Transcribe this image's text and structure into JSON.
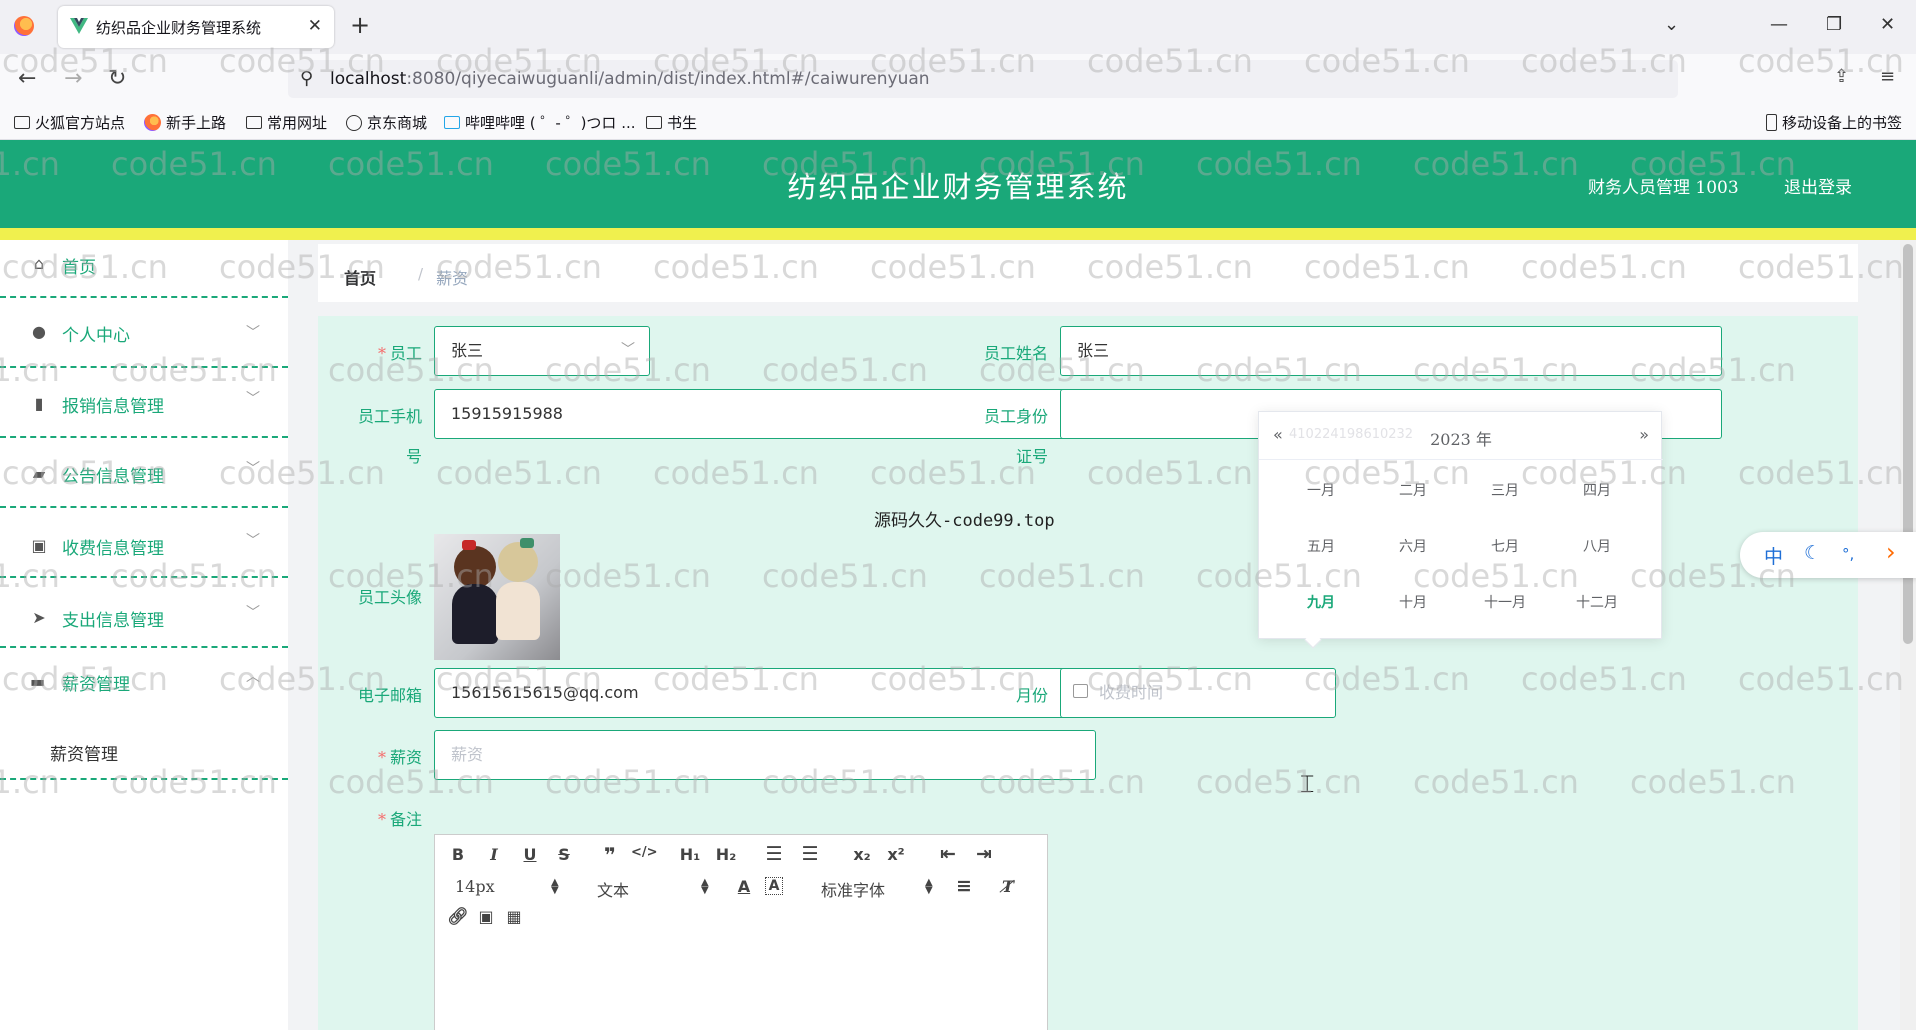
{
  "browser": {
    "tab_title": "纺织品企业财务管理系统",
    "tab_close": "✕",
    "new_tab": "+",
    "url_host": "localhost",
    "url_rest": ":8080/qiyecaiwuguanli/admin/dist/index.html#/caiwurenyuan",
    "bookmarks": [
      "火狐官方站点",
      "新手上路",
      "常用网址",
      "京东商城",
      "哔哩哔哩 ( ゜- ゜)つロ ...",
      "书生"
    ],
    "mobile_bookmarks": "移动设备上的书签"
  },
  "header": {
    "title": "纺织品企业财务管理系统",
    "user": "财务人员管理 1003",
    "logout": "退出登录",
    "accent": "#1aa879"
  },
  "sidebar": {
    "items": [
      {
        "label": "首页",
        "icon": "home-icon"
      },
      {
        "label": "个人中心",
        "icon": "user-icon"
      },
      {
        "label": "报销信息管理",
        "icon": "chart-icon"
      },
      {
        "label": "公告信息管理",
        "icon": "wallet-icon"
      },
      {
        "label": "收费信息管理",
        "icon": "fee-icon"
      },
      {
        "label": "支出信息管理",
        "icon": "send-icon"
      },
      {
        "label": "薪资管理",
        "icon": "ticket-icon"
      }
    ],
    "sub_item": "薪资管理"
  },
  "breadcrumb": {
    "home": "首页",
    "sep": "/",
    "current": "薪资"
  },
  "form": {
    "employee_label": "员工",
    "employee_value": "张三",
    "name_label": "员工姓名",
    "name_value": "张三",
    "phone_label_1": "员工手机",
    "phone_label_2": "号",
    "phone_value": "15915915988",
    "id_label_1": "员工身份",
    "id_label_2": "证号",
    "avatar_label": "员工头像",
    "email_label": "电子邮箱",
    "email_value": "15615615615@qq.com",
    "month_label": "月份",
    "month_placeholder": "收费时间",
    "salary_label": "薪资",
    "salary_placeholder": "薪资",
    "remark_label": "备注"
  },
  "month_picker": {
    "prev": "«",
    "next": "»",
    "year": "2023 年",
    "ghost_text": "410224198610232",
    "months": [
      "一月",
      "二月",
      "三月",
      "四月",
      "五月",
      "六月",
      "七月",
      "八月",
      "九月",
      "十月",
      "十一月",
      "十二月"
    ],
    "current_month": "九月"
  },
  "editor": {
    "font_size": "14px",
    "text_style": "文本",
    "font_family": "标准字体"
  },
  "overlay_text": "源码久久-code99.top",
  "ime": {
    "lang": "中",
    "moon": "☾",
    "punct": "°,",
    "arrow": "›"
  },
  "watermark_text": "code51.cn"
}
